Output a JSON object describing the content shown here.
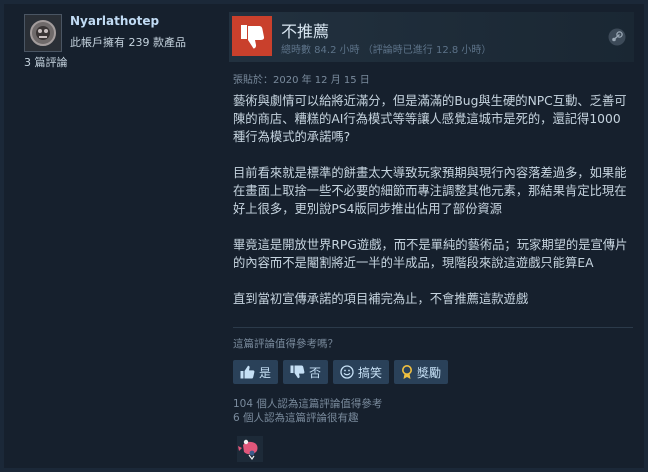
{
  "author": {
    "name": "Nyarlathotep",
    "products_owned": "此帳戶擁有 239 款產品",
    "reviews": "3 篇評論"
  },
  "header": {
    "verdict": "不推薦",
    "hours": "總時數 84.2 小時 （評論時已進行 12.8 小時）",
    "thumb_icon": "thumbs-down-icon",
    "platform_icon": "steam-icon"
  },
  "review": {
    "posted": "張貼於：2020 年 12 月 15 日",
    "body": "藝術與劇情可以給將近滿分，但是滿滿的Bug與生硬的NPC互動、乏善可陳的商店、糟糕的AI行為模式等等讓人感覺這城市是死的，還記得1000種行為模式的承諾嗎?\n\n目前看來就是標準的餅畫太大導致玩家預期與現行內容落差過多，如果能在畫面上取捨一些不必要的細節而專注調整其他元素，那結果肯定比現在好上很多，更別說PS4版同步推出佔用了部份資源\n\n畢竟這是開放世界RPG遊戲，而不是單純的藝術品；玩家期望的是宣傳片的內容而不是閹割將近一半的半成品，現階段來說這遊戲只能算EA\n\n直到當初宣傳承諾的項目補完為止，不會推薦這款遊戲"
  },
  "feedback": {
    "question": "這篇評論值得參考嗎？",
    "yes": "是",
    "no": "否",
    "funny": "搞笑",
    "award": "獎勵",
    "helpful_count": "104 個人認為這篇評論值得參考",
    "funny_count": "6 個人認為這篇評論很有趣"
  },
  "colors": {
    "background": "#1b2838",
    "card": "#16202d",
    "thumb_down": "#c9402c",
    "button": "#2a4159"
  }
}
